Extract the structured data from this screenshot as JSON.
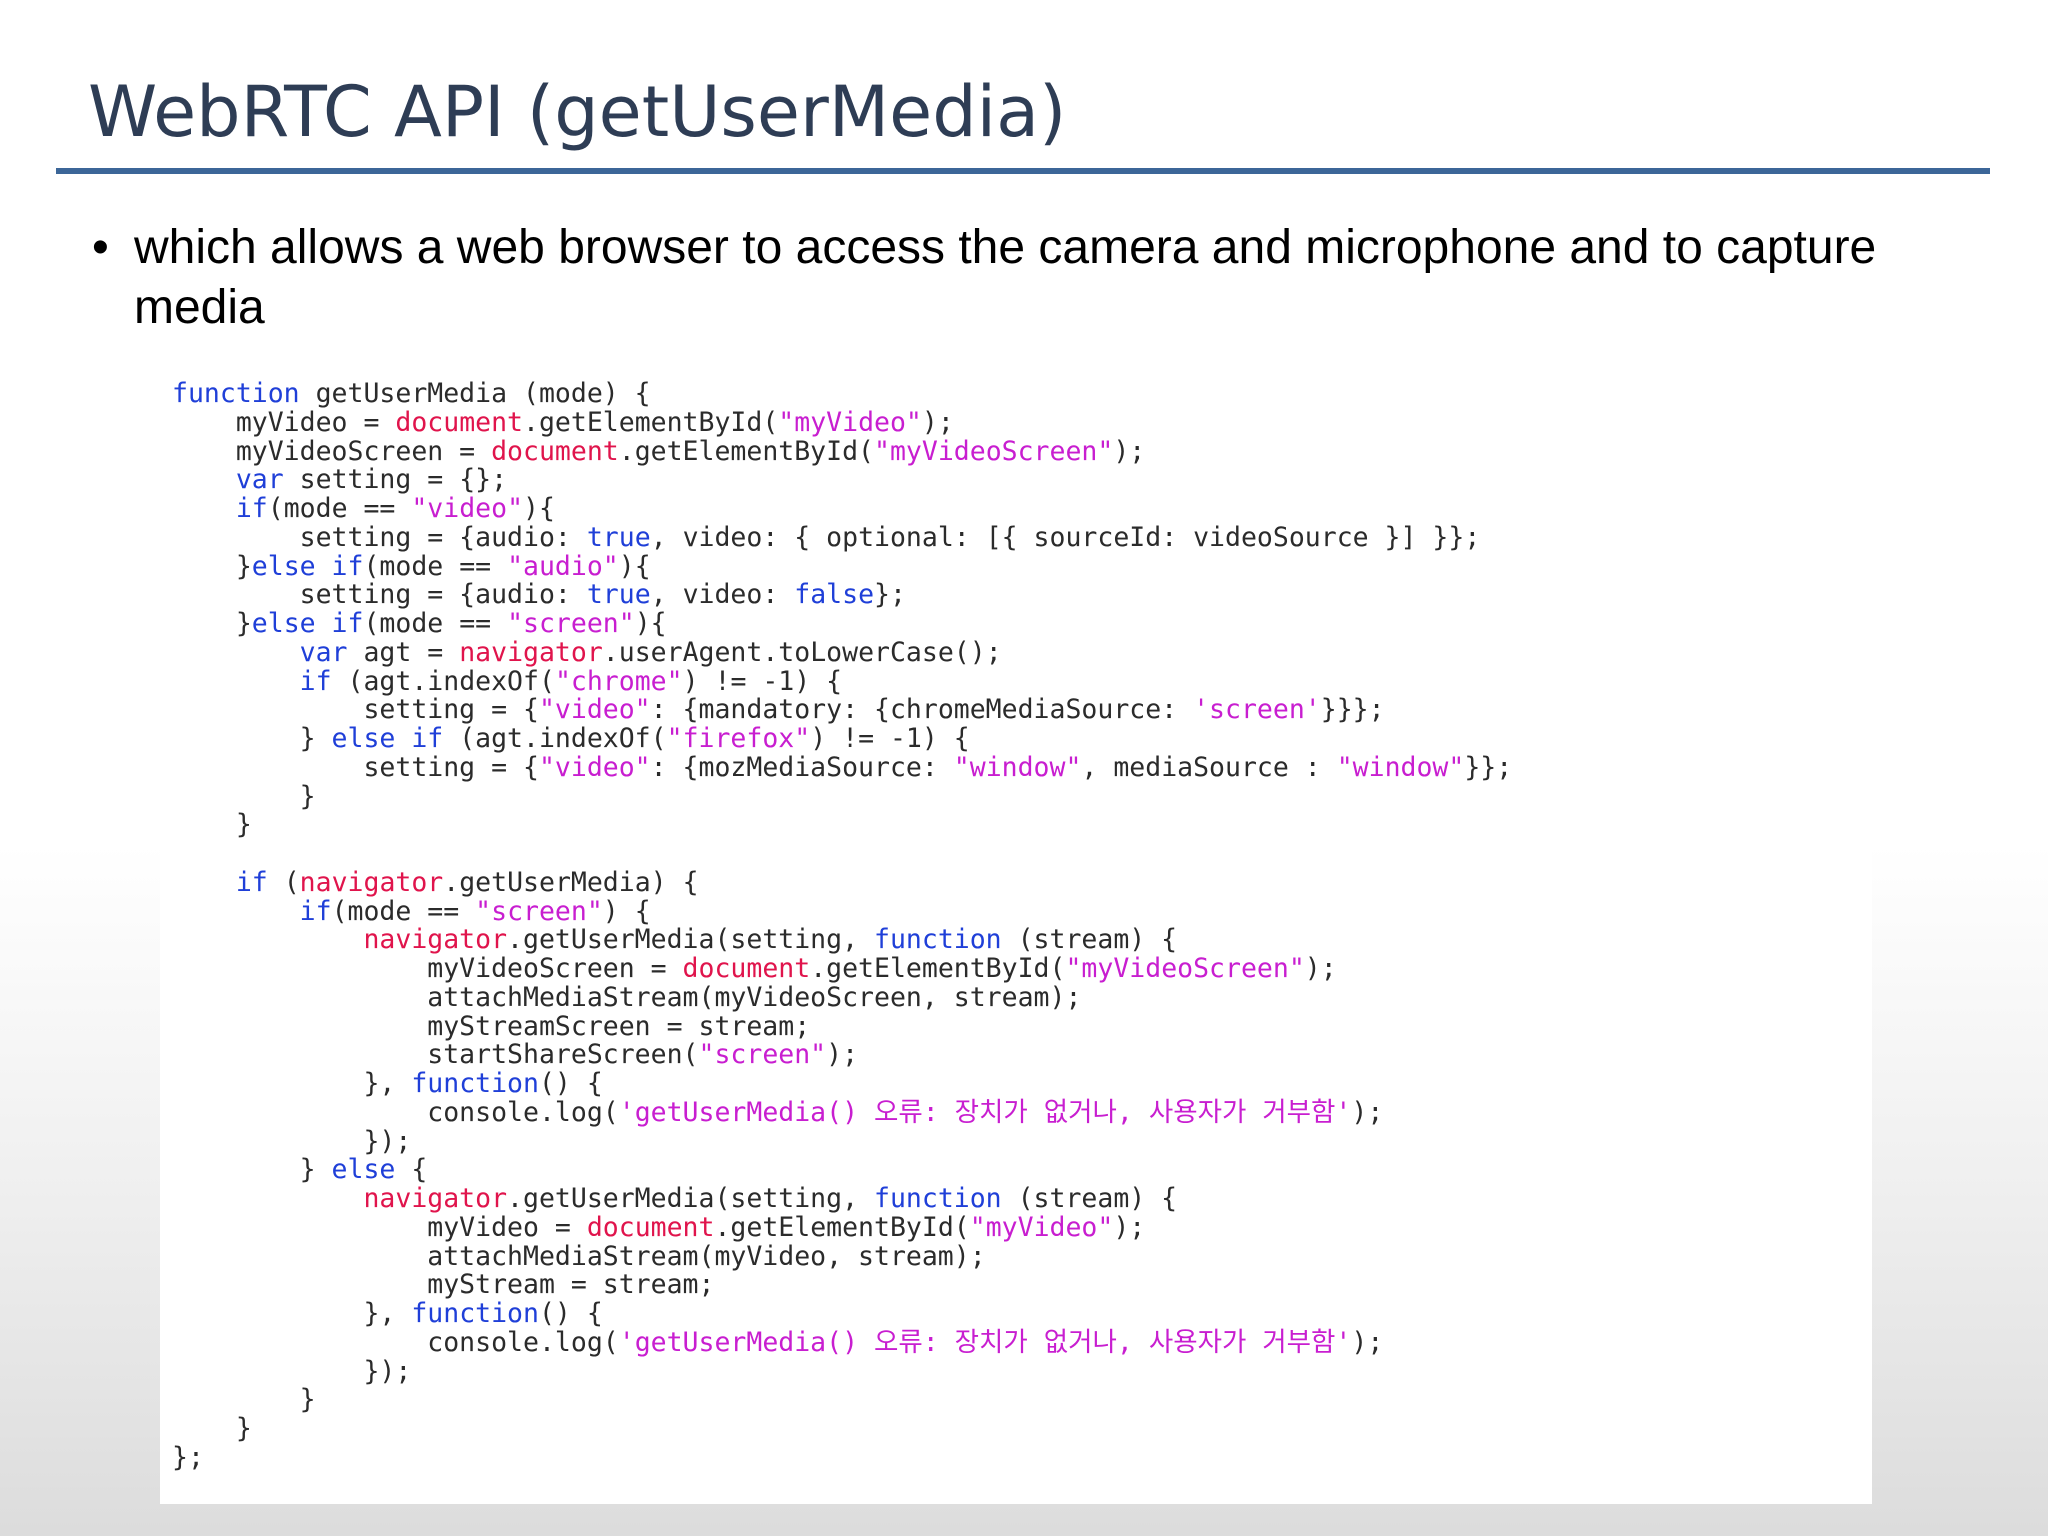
{
  "slide": {
    "title": "WebRTC API (getUserMedia)",
    "bullet_marker": "•",
    "bullet_text": "which allows a web browser to access the camera and microphone and to capture media"
  },
  "colors": {
    "title_text": "#2e3d55",
    "title_rule": "#3c6698",
    "code_keyword": "#1f3fd8",
    "code_object": "#e0144c",
    "code_string": "#c81ed0",
    "code_plain": "#2b2b2b"
  },
  "code": {
    "lines": [
      [
        [
          "kw",
          "function"
        ],
        [
          "pl",
          " getUserMedia (mode) {"
        ]
      ],
      [
        [
          "pl",
          "    myVideo = "
        ],
        [
          "obj",
          "document"
        ],
        [
          "pl",
          ".getElementById("
        ],
        [
          "str",
          "\"myVideo\""
        ],
        [
          "pl",
          ");"
        ]
      ],
      [
        [
          "pl",
          "    myVideoScreen = "
        ],
        [
          "obj",
          "document"
        ],
        [
          "pl",
          ".getElementById("
        ],
        [
          "str",
          "\"myVideoScreen\""
        ],
        [
          "pl",
          ");"
        ]
      ],
      [
        [
          "pl",
          "    "
        ],
        [
          "kw",
          "var"
        ],
        [
          "pl",
          " setting = {};"
        ]
      ],
      [
        [
          "pl",
          "    "
        ],
        [
          "kw",
          "if"
        ],
        [
          "pl",
          "(mode == "
        ],
        [
          "str",
          "\"video\""
        ],
        [
          "pl",
          "){"
        ]
      ],
      [
        [
          "pl",
          "        setting = {audio: "
        ],
        [
          "kw",
          "true"
        ],
        [
          "pl",
          ", video: { optional: [{ sourceId: videoSource }] }};"
        ]
      ],
      [
        [
          "pl",
          "    }"
        ],
        [
          "kw",
          "else if"
        ],
        [
          "pl",
          "(mode == "
        ],
        [
          "str",
          "\"audio\""
        ],
        [
          "pl",
          "){"
        ]
      ],
      [
        [
          "pl",
          "        setting = {audio: "
        ],
        [
          "kw",
          "true"
        ],
        [
          "pl",
          ", video: "
        ],
        [
          "kw",
          "false"
        ],
        [
          "pl",
          "};"
        ]
      ],
      [
        [
          "pl",
          "    }"
        ],
        [
          "kw",
          "else if"
        ],
        [
          "pl",
          "(mode == "
        ],
        [
          "str",
          "\"screen\""
        ],
        [
          "pl",
          "){"
        ]
      ],
      [
        [
          "pl",
          "        "
        ],
        [
          "kw",
          "var"
        ],
        [
          "pl",
          " agt = "
        ],
        [
          "obj",
          "navigator"
        ],
        [
          "pl",
          ".userAgent.toLowerCase();"
        ]
      ],
      [
        [
          "pl",
          "        "
        ],
        [
          "kw",
          "if"
        ],
        [
          "pl",
          " (agt.indexOf("
        ],
        [
          "str",
          "\"chrome\""
        ],
        [
          "pl",
          ") != -1) {"
        ]
      ],
      [
        [
          "pl",
          "            setting = {"
        ],
        [
          "str",
          "\"video\""
        ],
        [
          "pl",
          ": {mandatory: {chromeMediaSource: "
        ],
        [
          "str",
          "'screen'"
        ],
        [
          "pl",
          "}}};"
        ]
      ],
      [
        [
          "pl",
          "        } "
        ],
        [
          "kw",
          "else if"
        ],
        [
          "pl",
          " (agt.indexOf("
        ],
        [
          "str",
          "\"firefox\""
        ],
        [
          "pl",
          ") != -1) {"
        ]
      ],
      [
        [
          "pl",
          "            setting = {"
        ],
        [
          "str",
          "\"video\""
        ],
        [
          "pl",
          ": {mozMediaSource: "
        ],
        [
          "str",
          "\"window\""
        ],
        [
          "pl",
          ", mediaSource : "
        ],
        [
          "str",
          "\"window\""
        ],
        [
          "pl",
          "}};"
        ]
      ],
      [
        [
          "pl",
          "        }"
        ]
      ],
      [
        [
          "pl",
          "    }"
        ]
      ],
      [],
      [
        [
          "pl",
          "    "
        ],
        [
          "kw",
          "if"
        ],
        [
          "pl",
          " ("
        ],
        [
          "obj",
          "navigator"
        ],
        [
          "pl",
          ".getUserMedia) {"
        ]
      ],
      [
        [
          "pl",
          "        "
        ],
        [
          "kw",
          "if"
        ],
        [
          "pl",
          "(mode == "
        ],
        [
          "str",
          "\"screen\""
        ],
        [
          "pl",
          ") {"
        ]
      ],
      [
        [
          "pl",
          "            "
        ],
        [
          "obj",
          "navigator"
        ],
        [
          "pl",
          ".getUserMedia(setting, "
        ],
        [
          "kw",
          "function"
        ],
        [
          "pl",
          " (stream) {"
        ]
      ],
      [
        [
          "pl",
          "                myVideoScreen = "
        ],
        [
          "obj",
          "document"
        ],
        [
          "pl",
          ".getElementById("
        ],
        [
          "str",
          "\"myVideoScreen\""
        ],
        [
          "pl",
          ");"
        ]
      ],
      [
        [
          "pl",
          "                attachMediaStream(myVideoScreen, stream);"
        ]
      ],
      [
        [
          "pl",
          "                myStreamScreen = stream;"
        ]
      ],
      [
        [
          "pl",
          "                startShareScreen("
        ],
        [
          "str",
          "\"screen\""
        ],
        [
          "pl",
          ");"
        ]
      ],
      [
        [
          "pl",
          "            }, "
        ],
        [
          "kw",
          "function"
        ],
        [
          "pl",
          "() {"
        ]
      ],
      [
        [
          "pl",
          "                console.log("
        ],
        [
          "str",
          "'getUserMedia() 오류: 장치가 없거나, 사용자가 거부함'"
        ],
        [
          "pl",
          ");"
        ]
      ],
      [
        [
          "pl",
          "            });"
        ]
      ],
      [
        [
          "pl",
          "        } "
        ],
        [
          "kw",
          "else"
        ],
        [
          "pl",
          " {"
        ]
      ],
      [
        [
          "pl",
          "            "
        ],
        [
          "obj",
          "navigator"
        ],
        [
          "pl",
          ".getUserMedia(setting, "
        ],
        [
          "kw",
          "function"
        ],
        [
          "pl",
          " (stream) {"
        ]
      ],
      [
        [
          "pl",
          "                myVideo = "
        ],
        [
          "obj",
          "document"
        ],
        [
          "pl",
          ".getElementById("
        ],
        [
          "str",
          "\"myVideo\""
        ],
        [
          "pl",
          ");"
        ]
      ],
      [
        [
          "pl",
          "                attachMediaStream(myVideo, stream);"
        ]
      ],
      [
        [
          "pl",
          "                myStream = stream;"
        ]
      ],
      [
        [
          "pl",
          "            }, "
        ],
        [
          "kw",
          "function"
        ],
        [
          "pl",
          "() {"
        ]
      ],
      [
        [
          "pl",
          "                console.log("
        ],
        [
          "str",
          "'getUserMedia() 오류: 장치가 없거나, 사용자가 거부함'"
        ],
        [
          "pl",
          ");"
        ]
      ],
      [
        [
          "pl",
          "            });"
        ]
      ],
      [
        [
          "pl",
          "        }"
        ]
      ],
      [
        [
          "pl",
          "    }"
        ]
      ],
      [
        [
          "pl",
          "};"
        ]
      ]
    ]
  }
}
